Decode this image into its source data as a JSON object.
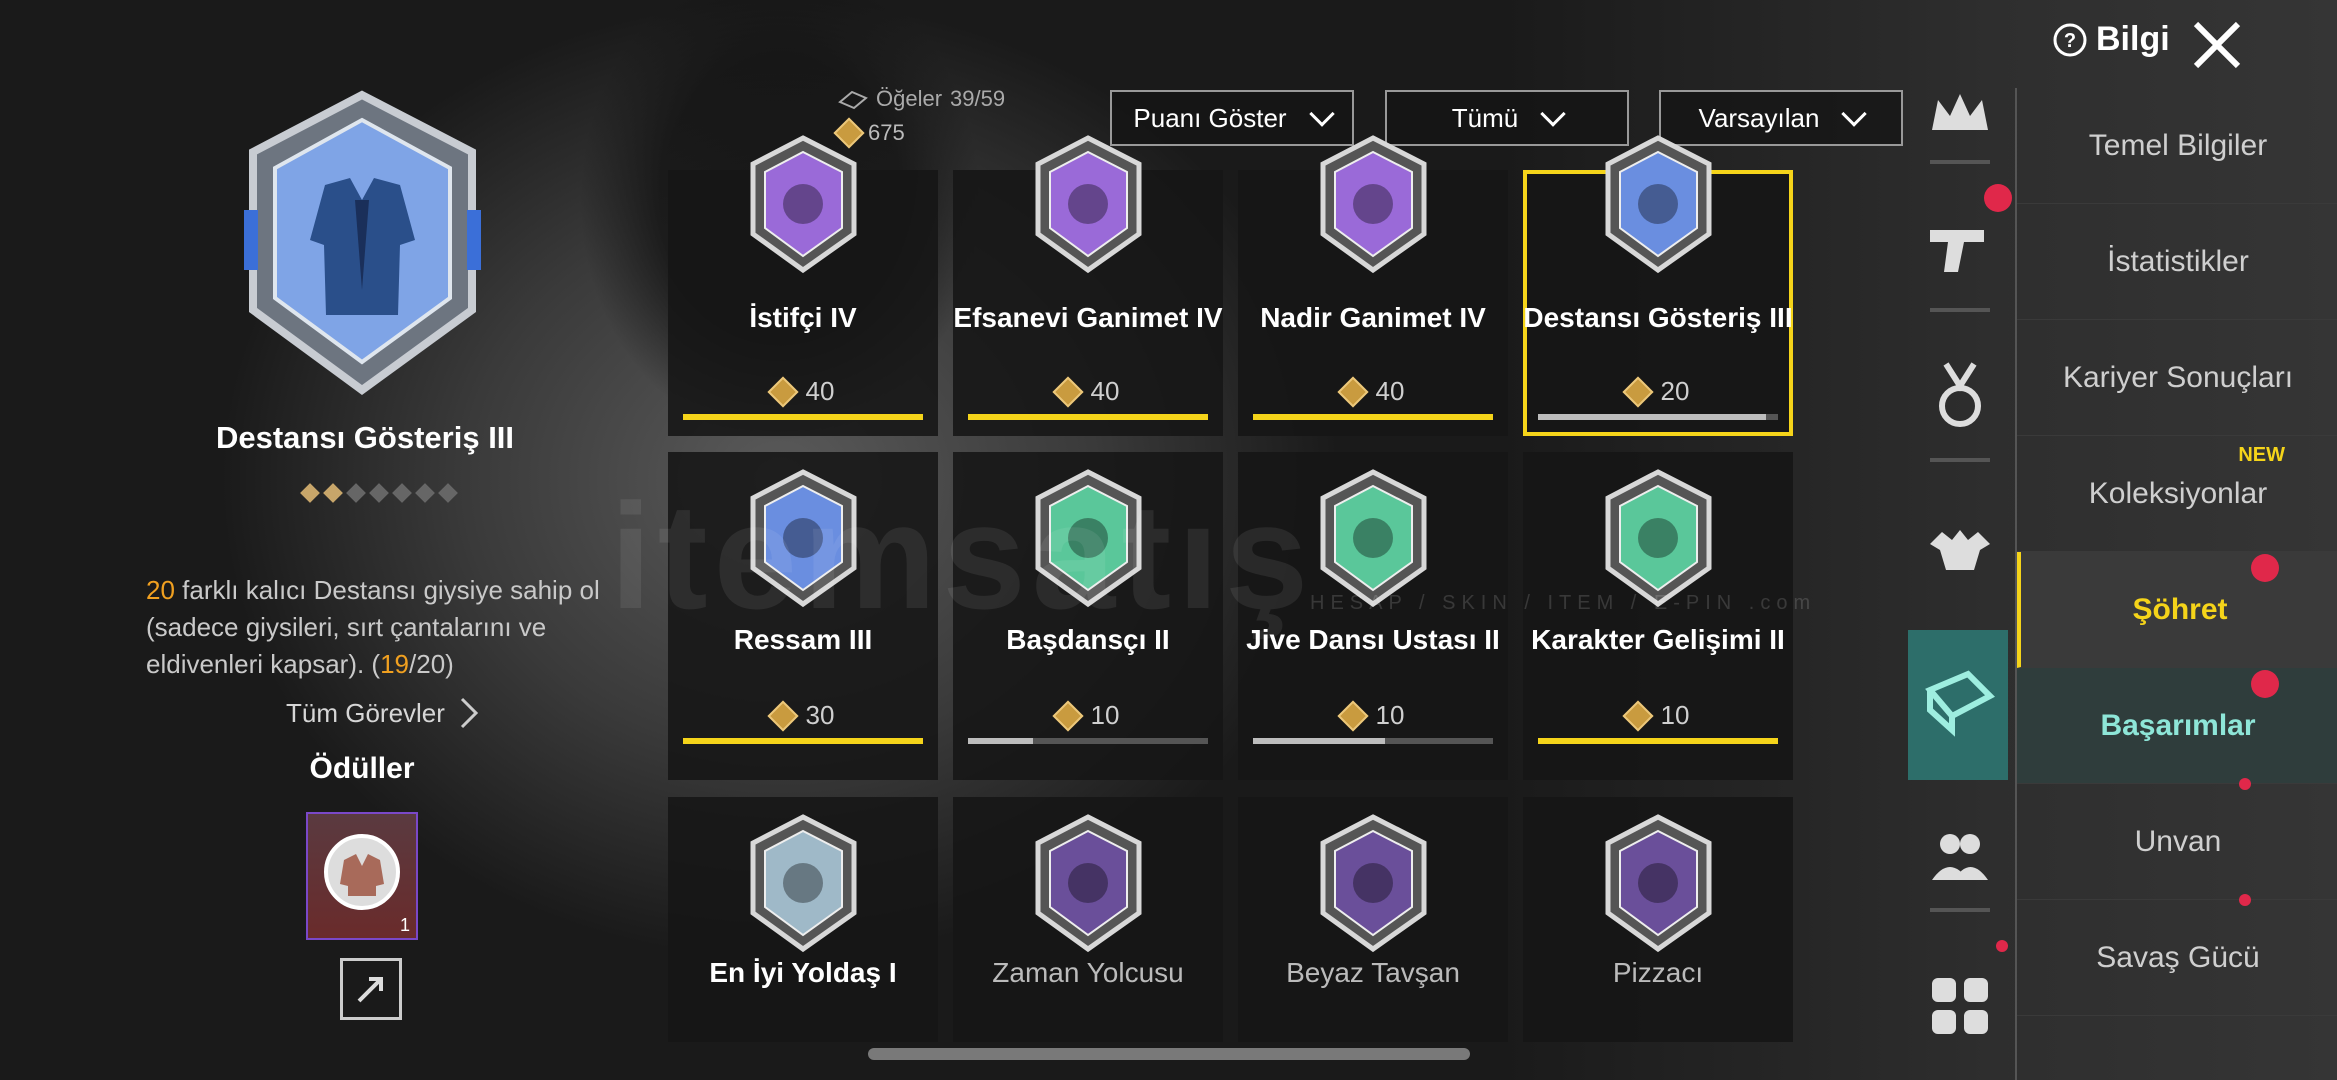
{
  "header": {
    "items_label": "Öğeler",
    "items_count": "39/59",
    "points_total": "675",
    "dropdowns": [
      {
        "label": "Puanı Göster"
      },
      {
        "label": "Tümü"
      },
      {
        "label": "Varsayılan"
      }
    ],
    "info_label": "Bilgi"
  },
  "selected": {
    "title": "Destansı Gösteriş III",
    "stars_filled": 2,
    "stars_total": 7,
    "desc_count": "20",
    "desc_text": " farklı kalıcı Destansı giysiye sahip ol (sadece giysileri, sırt çantalarını ve eldivenleri kapsar). (",
    "desc_progress_current": "19",
    "desc_progress_total": "/20)",
    "all_tasks_label": "Tüm Görevler",
    "rewards_title": "Ödüller",
    "reward_count": "1"
  },
  "cards": [
    {
      "name": "İstifçi IV",
      "points": "40",
      "progress": 1.0,
      "color": "#9a6ad8"
    },
    {
      "name": "Efsanevi Ganimet IV",
      "points": "40",
      "progress": 1.0,
      "color": "#9a6ad8"
    },
    {
      "name": "Nadir Ganimet IV",
      "points": "40",
      "progress": 1.0,
      "color": "#9a6ad8"
    },
    {
      "name": "Destansı Gösteriş III",
      "points": "20",
      "progress": 0.95,
      "color": "#6a8ee0"
    },
    {
      "name": "Ressam III",
      "points": "30",
      "progress": 1.0,
      "color": "#6a8ee0"
    },
    {
      "name": "Başdansçı II",
      "points": "10",
      "progress": 0.27,
      "color": "#5ac79a"
    },
    {
      "name": "Jive Dansı Ustası II",
      "points": "10",
      "progress": 0.55,
      "color": "#5ac79a"
    },
    {
      "name": "Karakter Gelişimi II",
      "points": "10",
      "progress": 1.0,
      "color": "#5ac79a"
    },
    {
      "name": "En İyi Yoldaş I",
      "points": "",
      "progress": 0,
      "color": "#9fb9c8"
    },
    {
      "name": "Zaman Yolcusu",
      "points": "",
      "progress": 0,
      "color": "#6a4f9a"
    },
    {
      "name": "Beyaz Tavşan",
      "points": "",
      "progress": 0,
      "color": "#6a4f9a"
    },
    {
      "name": "Pizzacı",
      "points": "",
      "progress": 0,
      "color": "#6a4f9a"
    }
  ],
  "menu": {
    "items": [
      {
        "label": "Temel Bilgiler"
      },
      {
        "label": "İstatistikler"
      },
      {
        "label": "Kariyer Sonuçları"
      },
      {
        "label": "Koleksiyonlar",
        "tag": "NEW"
      },
      {
        "label": "Şöhret"
      },
      {
        "label": "Başarımlar"
      },
      {
        "label": "Unvan"
      },
      {
        "label": "Savaş Gücü"
      }
    ]
  },
  "watermark": {
    "main": "itemsatış",
    "sub": "HESAP / SKIN / ITEM / E-PIN .com"
  },
  "colors": {
    "accent": "#f5d41a",
    "teal": "#2d6e6a",
    "notify": "#e0284a"
  }
}
